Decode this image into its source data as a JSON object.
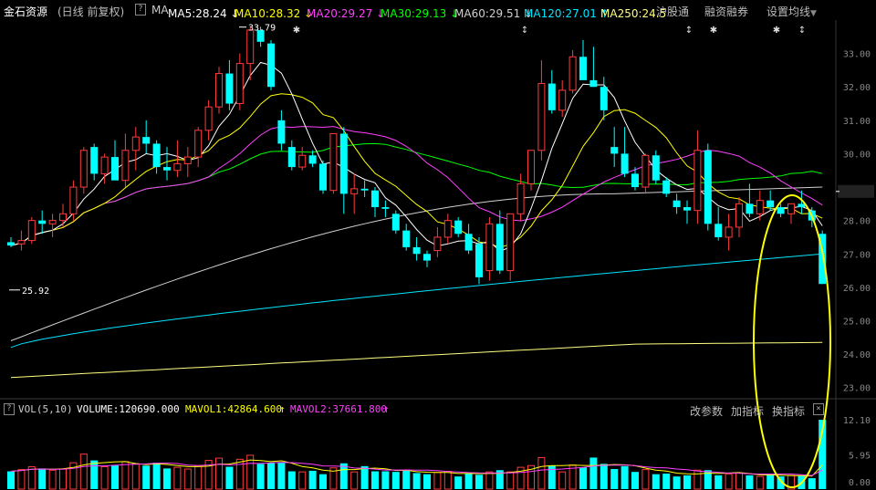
{
  "stock": {
    "name": "金石资源",
    "period": "(日线 前复权)"
  },
  "ma_legend": {
    "ma_label": "MA",
    "items": [
      {
        "label": "MA5:28.24",
        "arrow": "↓",
        "color": "#ffffff"
      },
      {
        "label": "MA10:28.32",
        "arrow": "↓",
        "color": "#ffff00"
      },
      {
        "label": "MA20:29.27",
        "arrow": "↓",
        "color": "#ff40ff"
      },
      {
        "label": "MA30:29.13",
        "arrow": "↓",
        "color": "#00ff00"
      },
      {
        "label": "MA60:29.51",
        "arrow": "↓",
        "color": "#d0d0d0"
      },
      {
        "label": "MA120:27.01",
        "arrow": "↑",
        "color": "#00e5ff"
      },
      {
        "label": "MA250:24.5",
        "arrow": "",
        "color": "#ffff80"
      }
    ]
  },
  "menus": {
    "hgt": "沪股通",
    "margin": "融资融券",
    "settings": "设置均线"
  },
  "price_axis": [
    "33.00",
    "32.00",
    "31.00",
    "30.00",
    "28.87",
    "28.00",
    "27.00",
    "26.00",
    "25.00",
    "24.00",
    "23.00"
  ],
  "current_price": "28.87",
  "annotations": {
    "high": "33.79",
    "low": "25.92"
  },
  "volume_bar": {
    "title": "VOL(5,10)",
    "volume": "VOLUME:120690.000",
    "mavol1": "MAVOL1:42864.600",
    "mavol1_arrow": "↑",
    "mavol2": "MAVOL2:37661.800",
    "mavol2_arrow": "↑",
    "btn_params": "改参数",
    "btn_add": "加指标",
    "btn_switch": "换指标",
    "close": "×"
  },
  "volume_axis": [
    "12.10",
    "5.95",
    "0.00"
  ],
  "colors": {
    "up": "#ff3b3b",
    "down": "#00ffff",
    "highlight": "#ffff00"
  },
  "chart_data": {
    "type": "candlestick",
    "candles": [
      [
        27.35,
        27.5,
        27.2,
        27.25
      ],
      [
        27.3,
        27.7,
        27.1,
        27.4
      ],
      [
        27.4,
        28.1,
        27.3,
        28.0
      ],
      [
        28.0,
        28.3,
        27.6,
        27.9
      ],
      [
        27.9,
        28.2,
        27.5,
        28.0
      ],
      [
        28.0,
        28.5,
        27.8,
        28.2
      ],
      [
        28.2,
        29.2,
        28.0,
        29.0
      ],
      [
        29.0,
        30.2,
        28.8,
        30.1
      ],
      [
        30.2,
        30.3,
        29.2,
        29.4
      ],
      [
        29.4,
        30.0,
        29.1,
        29.9
      ],
      [
        29.9,
        30.4,
        29.5,
        29.2
      ],
      [
        29.2,
        30.6,
        29.0,
        30.1
      ],
      [
        30.1,
        30.8,
        29.5,
        30.5
      ],
      [
        30.5,
        31.0,
        30.0,
        30.3
      ],
      [
        30.3,
        30.4,
        29.4,
        29.6
      ],
      [
        29.6,
        30.2,
        29.2,
        29.5
      ],
      [
        29.5,
        30.4,
        29.3,
        29.7
      ],
      [
        29.7,
        30.2,
        29.3,
        29.9
      ],
      [
        29.9,
        30.8,
        29.6,
        30.7
      ],
      [
        30.7,
        31.6,
        30.4,
        31.4
      ],
      [
        31.4,
        32.6,
        31.2,
        32.4
      ],
      [
        32.4,
        32.8,
        31.3,
        31.5
      ],
      [
        31.5,
        33.0,
        31.3,
        32.7
      ],
      [
        32.7,
        33.8,
        32.2,
        33.7
      ],
      [
        33.7,
        33.8,
        33.2,
        33.35
      ],
      [
        33.3,
        33.4,
        31.9,
        32.0
      ],
      [
        31.0,
        31.3,
        30.1,
        30.3
      ],
      [
        30.2,
        30.4,
        29.5,
        29.6
      ],
      [
        29.6,
        30.2,
        29.5,
        29.95
      ],
      [
        29.95,
        30.1,
        29.6,
        29.7
      ],
      [
        29.7,
        29.8,
        28.8,
        28.9
      ],
      [
        28.9,
        30.6,
        28.8,
        30.6
      ],
      [
        30.6,
        30.8,
        28.2,
        28.8
      ],
      [
        28.8,
        29.4,
        28.2,
        28.95
      ],
      [
        28.95,
        29.2,
        28.7,
        28.9
      ],
      [
        28.9,
        29.0,
        28.1,
        28.4
      ],
      [
        28.4,
        28.6,
        28.1,
        28.35
      ],
      [
        28.2,
        28.3,
        27.6,
        27.7
      ],
      [
        27.7,
        27.9,
        27.1,
        27.2
      ],
      [
        27.2,
        27.5,
        26.8,
        27.0
      ],
      [
        27.0,
        27.1,
        26.6,
        26.8
      ],
      [
        27.1,
        27.8,
        26.9,
        27.5
      ],
      [
        27.5,
        28.2,
        27.3,
        28.0
      ],
      [
        28.0,
        28.1,
        27.5,
        27.6
      ],
      [
        27.6,
        27.9,
        27.0,
        27.1
      ],
      [
        27.3,
        27.5,
        26.1,
        26.3
      ],
      [
        26.5,
        28.1,
        26.2,
        27.9
      ],
      [
        27.9,
        28.3,
        26.4,
        26.5
      ],
      [
        26.5,
        27.2,
        26.2,
        28.2
      ],
      [
        28.2,
        29.4,
        28.0,
        29.1
      ],
      [
        29.1,
        30.1,
        28.9,
        30.1
      ],
      [
        30.1,
        32.8,
        29.8,
        32.1
      ],
      [
        32.1,
        32.5,
        31.2,
        31.3
      ],
      [
        31.3,
        32.2,
        31.1,
        31.9
      ],
      [
        31.9,
        33.1,
        31.8,
        32.9
      ],
      [
        32.9,
        33.4,
        32.3,
        32.2
      ],
      [
        32.2,
        33.2,
        32.0,
        32.0
      ],
      [
        32.0,
        32.3,
        31.0,
        31.3
      ],
      [
        30.2,
        30.8,
        29.6,
        30.0
      ],
      [
        30.0,
        30.8,
        29.3,
        29.4
      ],
      [
        29.4,
        29.6,
        28.9,
        29.0
      ],
      [
        29.0,
        30.0,
        28.8,
        29.95
      ],
      [
        29.95,
        30.1,
        29.1,
        29.2
      ],
      [
        29.2,
        29.3,
        28.7,
        28.8
      ],
      [
        28.6,
        28.8,
        28.2,
        28.4
      ],
      [
        28.4,
        28.6,
        27.9,
        28.3
      ],
      [
        28.3,
        30.7,
        27.9,
        30.1
      ],
      [
        30.1,
        30.3,
        27.7,
        27.9
      ],
      [
        27.9,
        28.4,
        27.4,
        27.5
      ],
      [
        27.5,
        28.2,
        27.1,
        27.8
      ],
      [
        27.8,
        28.7,
        27.5,
        28.5
      ],
      [
        28.5,
        29.1,
        28.1,
        28.2
      ],
      [
        28.2,
        28.9,
        28.0,
        28.6
      ],
      [
        28.6,
        28.9,
        28.3,
        28.4
      ],
      [
        28.4,
        28.5,
        28.1,
        28.2
      ],
      [
        28.2,
        28.4,
        27.9,
        28.5
      ],
      [
        28.5,
        28.9,
        28.2,
        28.4
      ],
      [
        28.3,
        28.4,
        27.8,
        28.0
      ],
      [
        27.6,
        27.7,
        26.1,
        26.1
      ]
    ],
    "volumes": [
      3.1,
      3.4,
      3.9,
      3.6,
      3.3,
      3.5,
      4.6,
      6.1,
      5.0,
      3.9,
      4.2,
      4.8,
      4.4,
      4.1,
      4.6,
      3.6,
      3.8,
      3.5,
      4.1,
      5.0,
      5.4,
      3.9,
      5.2,
      5.9,
      4.4,
      4.6,
      4.6,
      3.1,
      3.0,
      3.2,
      2.6,
      3.7,
      4.5,
      3.0,
      4.0,
      3.1,
      3.1,
      3.0,
      3.2,
      2.8,
      2.6,
      2.9,
      3.1,
      2.2,
      2.8,
      2.5,
      3.0,
      3.3,
      3.0,
      3.8,
      4.1,
      5.5,
      4.1,
      3.0,
      4.2,
      3.8,
      5.5,
      4.4,
      3.5,
      4.0,
      3.0,
      3.4,
      2.6,
      2.7,
      2.2,
      2.4,
      3.3,
      3.3,
      2.4,
      2.6,
      2.8,
      2.4,
      2.2,
      2.6,
      2.2,
      2.4,
      2.3,
      1.9,
      12.1
    ],
    "price_ylim": [
      22.8,
      34.0
    ],
    "volume_ylim": [
      0,
      12.1
    ]
  }
}
